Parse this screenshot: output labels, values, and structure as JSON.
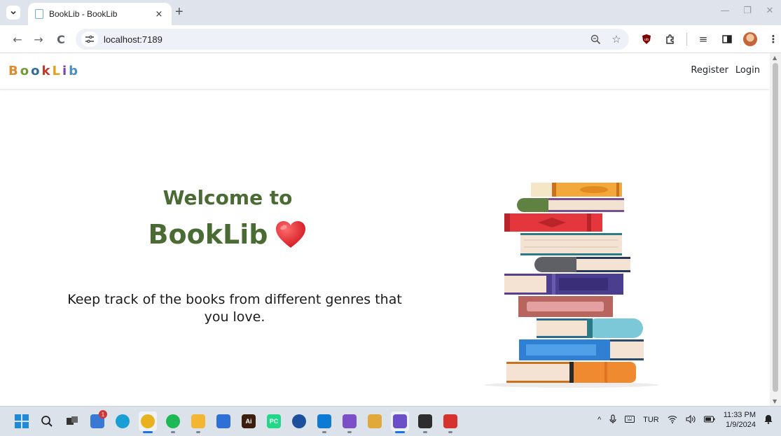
{
  "browser": {
    "tab_title": "BookLib - BookLib",
    "new_tab": "+",
    "close_tab": "×",
    "url": "localhost:7189"
  },
  "page": {
    "brand_letters": [
      {
        "char": "B",
        "color": "#e08a2e"
      },
      {
        "char": "o",
        "color": "#6f9b3a"
      },
      {
        "char": "o",
        "color": "#2f6e9b"
      },
      {
        "char": "k",
        "color": "#c0392b"
      },
      {
        "char": "L",
        "color": "#e3a21a"
      },
      {
        "char": "i",
        "color": "#7a49a5"
      },
      {
        "char": "b",
        "color": "#4a8ec2"
      }
    ],
    "nav": {
      "register": "Register",
      "login": "Login"
    },
    "hero": {
      "line1": "Welcome to",
      "line2": "BookLib",
      "description": "Keep track of the books from different genres that you love."
    },
    "colors": {
      "accent_green": "#4a6b33",
      "heart": "#e3262f"
    }
  },
  "taskbar": {
    "apps": [
      {
        "name": "start",
        "icon": "windows-icon",
        "color": "#0078d4"
      },
      {
        "name": "search",
        "icon": "search-icon",
        "color": "#333333"
      },
      {
        "name": "task-view",
        "icon": "task-view-icon",
        "color": "#333333"
      },
      {
        "name": "cloud",
        "icon": "cloud-icon",
        "color": "#3a78d6",
        "badge": "1"
      },
      {
        "name": "edge",
        "icon": "edge-icon",
        "color": "#1a9fd4"
      },
      {
        "name": "chrome",
        "icon": "chrome-icon",
        "color": "#e8b21e"
      },
      {
        "name": "spotify",
        "icon": "spotify-icon",
        "color": "#1db954"
      },
      {
        "name": "file-explorer",
        "icon": "folder-icon",
        "color": "#f2b632"
      },
      {
        "name": "word",
        "icon": "word-icon",
        "color": "#2f6fd6"
      },
      {
        "name": "illustrator",
        "icon": "illustrator-icon",
        "color": "#3b1e0e",
        "label": "Ai"
      },
      {
        "name": "pycharm",
        "icon": "pycharm-icon",
        "color": "#21d789",
        "label": "PC"
      },
      {
        "name": "app-round",
        "icon": "app-icon",
        "color": "#1c4f9c"
      },
      {
        "name": "vscode",
        "icon": "vscode-icon",
        "color": "#0e7ad4"
      },
      {
        "name": "visual-studio",
        "icon": "visual-studio-icon",
        "color": "#7b4fc8"
      },
      {
        "name": "snipping",
        "icon": "snipping-icon",
        "color": "#e0a93a"
      },
      {
        "name": "paint",
        "icon": "paint-icon",
        "color": "#6a4fc8"
      },
      {
        "name": "terminal",
        "icon": "terminal-icon",
        "color": "#2d2d2d"
      },
      {
        "name": "wps",
        "icon": "wps-icon",
        "color": "#d6322f"
      }
    ],
    "tray": {
      "language": "TUR",
      "time": "11:33 PM",
      "date": "1/9/2024"
    }
  }
}
